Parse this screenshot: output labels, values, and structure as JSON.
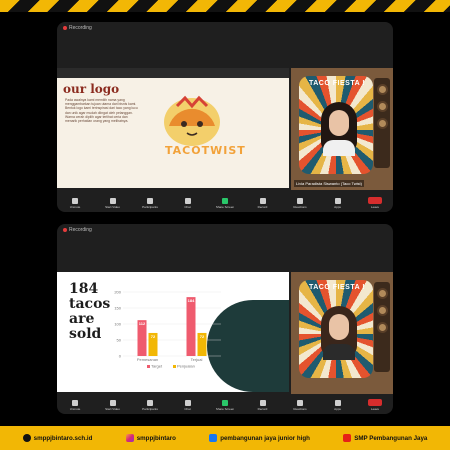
{
  "recording_label": "Recording",
  "tv": {
    "title": "TACO FIESTA !"
  },
  "window1": {
    "slide": {
      "heading": "our logo",
      "body": "Pada awalnya kami memilih nama yang menggambarkan tujuan utama dari bisnis kami. Bentuk logo kami terinspirasi dari taco yang lucu dan unik agar mudah diingat oleh pelanggan. Warna cerah dipilih agar terlihat ceria dan menarik perhatian orang yang melihatnya.",
      "brand_art": "TACOTWIST"
    },
    "participant_caption": "Livia Paradista Siswanto (Taco Twist)"
  },
  "window2": {
    "slide": {
      "big_text": [
        "184",
        "tacos",
        "are",
        "sold"
      ]
    },
    "participant_caption": ""
  },
  "controls": [
    {
      "label": "Unmute"
    },
    {
      "label": "Start Video"
    },
    {
      "label": "Participants"
    },
    {
      "label": "Chat"
    },
    {
      "label": "Share Screen"
    },
    {
      "label": "Record"
    },
    {
      "label": "Reactions"
    },
    {
      "label": "Apps"
    },
    {
      "label": "Leave"
    }
  ],
  "chart_data": {
    "type": "bar",
    "categories": [
      "Pemesanan",
      "Terjual"
    ],
    "series": [
      {
        "name": "Target",
        "values": [
          112,
          184
        ],
        "color": "#ef5b6e"
      },
      {
        "name": "Penjualan",
        "values": [
          72,
          72
        ],
        "color": "#f2b705"
      }
    ],
    "ylim": [
      0,
      200
    ],
    "yticks": [
      0,
      50,
      100,
      150,
      200
    ],
    "title": "",
    "xlabel": "",
    "ylabel": ""
  },
  "footer": {
    "website": "smppjbintaro.sch.id",
    "instagram": "smppjbintaro",
    "facebook": "pembangunan jaya junior high",
    "youtube": "SMP Pembangunan Jaya"
  }
}
